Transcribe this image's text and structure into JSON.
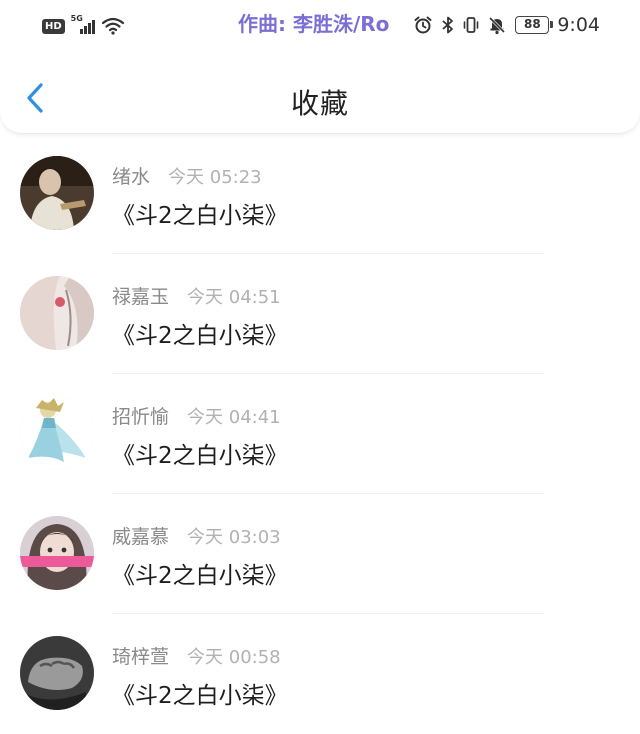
{
  "status_bar": {
    "hd": "HD",
    "network": "5G",
    "lyric": "作曲: 李胜洙/Ro",
    "battery": "88",
    "time": "9:04"
  },
  "header": {
    "title": "收藏"
  },
  "favorites": [
    {
      "name": "绪水",
      "time": "今天 05:23",
      "content": "《斗2之白小柒》"
    },
    {
      "name": "禄嘉玉",
      "time": "今天 04:51",
      "content": "《斗2之白小柒》"
    },
    {
      "name": "招忻愉",
      "time": "今天 04:41",
      "content": "《斗2之白小柒》"
    },
    {
      "name": "威嘉慕",
      "time": "今天 03:03",
      "content": "《斗2之白小柒》"
    },
    {
      "name": "琦梓萱",
      "time": "今天 00:58",
      "content": "《斗2之白小柒》"
    }
  ],
  "colors": {
    "accent": "#2f8fe0",
    "name_text": "#8a8a8a",
    "time_text": "#b2b2b2"
  }
}
